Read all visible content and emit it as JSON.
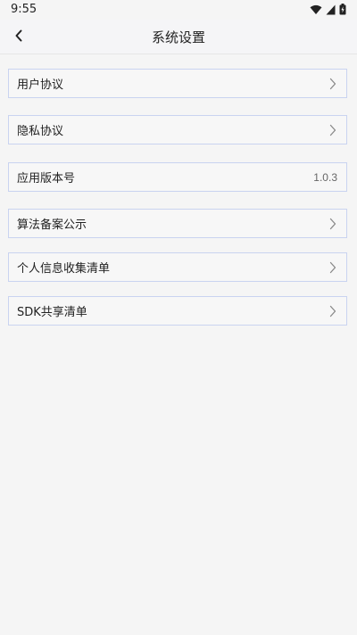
{
  "status_bar": {
    "time": "9:55",
    "icons": [
      "wifi-icon",
      "signal-icon",
      "battery-charging-icon"
    ]
  },
  "nav": {
    "back_icon": "chevron-left-icon",
    "title": "系统设置"
  },
  "items": [
    {
      "label": "用户协议",
      "action": "chevron-right-icon"
    },
    {
      "label": "隐私协议",
      "action": "chevron-right-icon"
    },
    {
      "label": "应用版本号",
      "value": "1.0.3"
    },
    {
      "label": "算法备案公示",
      "action": "chevron-right-icon"
    },
    {
      "label": "个人信息收集清单",
      "action": "chevron-right-icon"
    },
    {
      "label": "SDK共享清单",
      "action": "chevron-right-icon"
    }
  ],
  "colors": {
    "item_border": "#c9d3f0",
    "background": "#f5f5f5",
    "text": "#222222",
    "chevron": "#888888"
  }
}
